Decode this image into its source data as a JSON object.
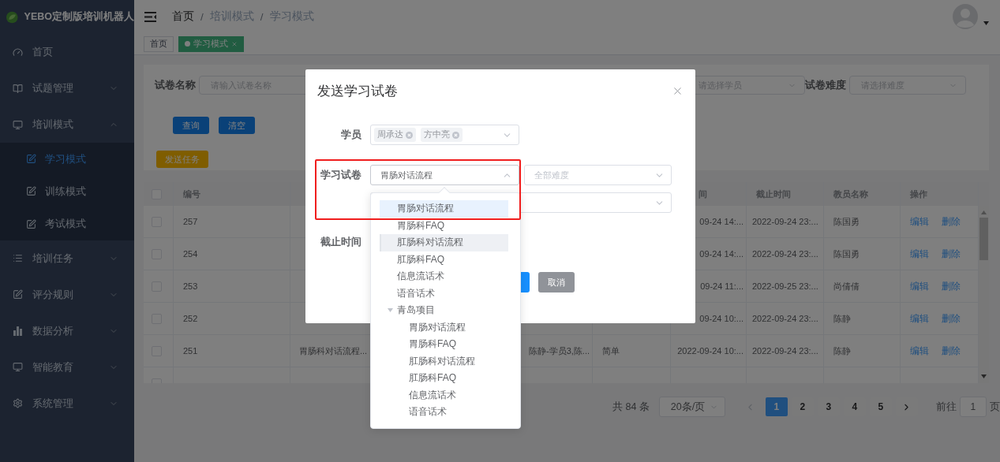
{
  "sidebar": {
    "title": "YEBO定制版培训机器人",
    "items": [
      {
        "label": "首页",
        "kind": "link"
      },
      {
        "label": "试题管理",
        "kind": "submenu",
        "expanded": false
      },
      {
        "label": "培训模式",
        "kind": "submenu",
        "expanded": true,
        "children": [
          {
            "label": "学习模式",
            "selected": true
          },
          {
            "label": "训练模式",
            "selected": false
          },
          {
            "label": "考试模式",
            "selected": false
          }
        ]
      },
      {
        "label": "培训任务",
        "kind": "submenu",
        "expanded": false
      },
      {
        "label": "评分规则",
        "kind": "submenu",
        "expanded": false
      },
      {
        "label": "数据分析",
        "kind": "submenu",
        "expanded": false
      },
      {
        "label": "智能教育",
        "kind": "submenu",
        "expanded": false
      },
      {
        "label": "系统管理",
        "kind": "submenu",
        "expanded": false
      }
    ]
  },
  "header": {
    "breadcrumb": [
      "首页",
      "培训模式",
      "学习模式"
    ],
    "separator": "/"
  },
  "tags": [
    {
      "label": "首页",
      "selected": false
    },
    {
      "label": "学习模式",
      "selected": true
    }
  ],
  "filters": {
    "fields": [
      {
        "label": "试卷名称",
        "placeholder": "请输入试卷名称"
      },
      {
        "placeholder": "请选择学员"
      },
      {
        "label": "试卷难度",
        "placeholder": "请选择难度"
      }
    ],
    "buttons": [
      "查询",
      "清空"
    ],
    "send_button": "发送任务"
  },
  "table": {
    "header": {
      "checked": false,
      "id": "编号",
      "start": "间",
      "end": "截止时间",
      "teacher": "教员名称",
      "actions": "操作"
    },
    "rows": [
      {
        "checked": false,
        "id": "257",
        "start": "09-24 14:...",
        "end": "2022-09-24 23:...",
        "teacher": "陈国勇",
        "actions": [
          "编辑",
          "删除"
        ]
      },
      {
        "checked": false,
        "id": "254",
        "start": "09-24 14:...",
        "end": "2022-09-24 23:...",
        "teacher": "陈国勇",
        "actions": [
          "编辑",
          "删除"
        ]
      },
      {
        "checked": false,
        "id": "253",
        "start": "09-24 11:...",
        "end": "2022-09-25 23:...",
        "teacher": "尚倩倩",
        "actions": [
          "编辑",
          "删除"
        ]
      },
      {
        "checked": false,
        "id": "252",
        "start": "09-24 10:...",
        "end": "2022-09-24 23:...",
        "teacher": "陈静",
        "actions": [
          "编辑",
          "删除"
        ]
      },
      {
        "checked": false,
        "id": "251",
        "paper": "胃肠科对话流程...",
        "students": "陈静-学员3,陈...",
        "difficulty": "简单",
        "start": "2022-09-24 10:...",
        "end": "2022-09-24 23:...",
        "teacher": "陈静",
        "actions": [
          "编辑",
          "删除"
        ]
      },
      {
        "checked": false
      }
    ]
  },
  "pagination": {
    "total": "共 84 条",
    "page_size": "20条/页",
    "pages": [
      {
        "label": "1",
        "selected": true
      },
      {
        "label": "2",
        "selected": false
      },
      {
        "label": "3",
        "selected": false
      },
      {
        "label": "4",
        "selected": false
      },
      {
        "label": "5",
        "selected": false
      }
    ],
    "goto_label": "前往",
    "goto_value": "1",
    "goto_suffix": "页"
  },
  "dialog": {
    "title": "发送学习试卷",
    "student_label": "学员",
    "students": [
      "周承达",
      "方中亮"
    ],
    "paper_label": "学习试卷",
    "paper_value": "胃肠对话流程",
    "paper_open": true,
    "difficulty_placeholder": "全部难度",
    "deadline_label": "截止时间",
    "cancel_button": "取消"
  },
  "dropdown": {
    "items": [
      {
        "label": "胃肠对话流程",
        "selected": true,
        "hovered": false
      },
      {
        "label": "胃肠科FAQ",
        "selected": false,
        "hovered": false
      },
      {
        "label": "肛肠科对话流程",
        "selected": false,
        "hovered": true
      },
      {
        "label": "肛肠科FAQ",
        "selected": false,
        "hovered": false
      },
      {
        "label": "信息流话术",
        "selected": false,
        "hovered": false
      },
      {
        "label": "语音话术",
        "selected": false,
        "hovered": false
      },
      {
        "label": "青岛项目",
        "selected": false,
        "hovered": false,
        "expanded": true,
        "children": [
          {
            "label": "胃肠对话流程",
            "selected": false,
            "hovered": false
          },
          {
            "label": "胃肠科FAQ",
            "selected": false,
            "hovered": false
          },
          {
            "label": "肛肠科对话流程",
            "selected": false,
            "hovered": false
          },
          {
            "label": "肛肠科FAQ",
            "selected": false,
            "hovered": false
          },
          {
            "label": "信息流话术",
            "selected": false,
            "hovered": false
          },
          {
            "label": "语音话术",
            "selected": false,
            "hovered": false
          }
        ]
      }
    ]
  }
}
